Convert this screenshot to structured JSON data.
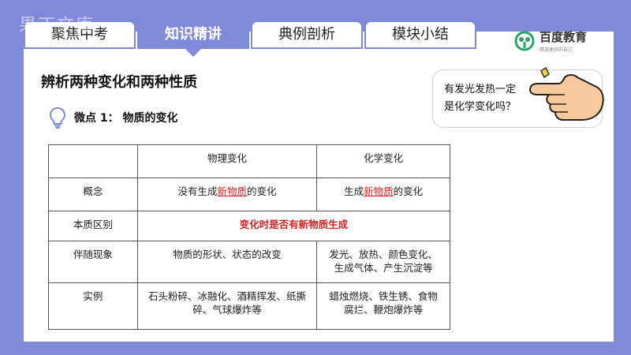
{
  "watermark": "果丁文库",
  "tabs": [
    {
      "label": "聚焦中考"
    },
    {
      "label": "知识精讲"
    },
    {
      "label": "典例剖析"
    },
    {
      "label": "模块小结"
    }
  ],
  "logo": {
    "name": "百度教育",
    "slogan": "精进更好的自己"
  },
  "heading": "辨析两种变化和两种性质",
  "subheading": "微点 1： 物质的变化",
  "bubble": {
    "line1": "有发光发热一定",
    "line2": "是化学变化吗？"
  },
  "table": {
    "header": {
      "physical": "物理变化",
      "chemical": "化学变化"
    },
    "concept": {
      "label": "概念",
      "physical_pre": "没有生成",
      "physical_key": "新物质",
      "physical_post": "的变化",
      "chemical_pre": "生成",
      "chemical_key": "新物质",
      "chemical_post": "的变化"
    },
    "essence": {
      "label": "本质区别",
      "value": "变化时是否有新物质生成"
    },
    "phenomena": {
      "label": "伴随现象",
      "physical": "物质的形状、状态的改变",
      "chemical_l1": "发光、放热、颜色变化、",
      "chemical_l2": "生成气体、产生沉淀等"
    },
    "examples": {
      "label": "实例",
      "physical_l1": "石头粉碎、冰融化、酒精挥发、纸撕",
      "physical_l2": "碎、气球爆炸等",
      "chemical_l1": "蜡烛燃烧、铁生锈、食物",
      "chemical_l2": "腐烂、鞭炮爆炸等"
    }
  },
  "colors": {
    "accent": "#7f8ad9",
    "highlight": "#e02020",
    "logo_green": "#2aa56a"
  }
}
